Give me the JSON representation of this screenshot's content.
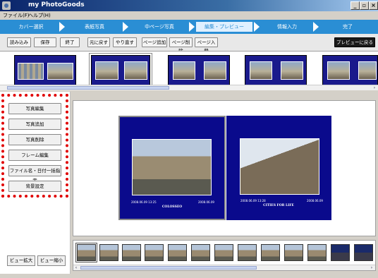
{
  "window": {
    "title": "my PhotoGoods",
    "minimize": "_",
    "maximize": "▫",
    "close": "×"
  },
  "menu": [
    "ファイル(F)",
    "ヘルプ(H)"
  ],
  "steps": [
    {
      "label": "カバー選択",
      "active": false
    },
    {
      "label": "表紙写真",
      "active": false
    },
    {
      "label": "中ページ写真",
      "active": false
    },
    {
      "label": "編集・プレビュー",
      "active": true
    },
    {
      "label": "情報入力",
      "active": false
    },
    {
      "label": "完了",
      "active": false
    }
  ],
  "toolbar": {
    "load": "読み込み",
    "save": "保存",
    "exit": "終了",
    "undo": "元に戻す",
    "redo": "やり直す",
    "add_page": "ページ追加",
    "delete_page": "ページ削除",
    "swap_page": "ページ入替",
    "back_to_preview": "プレビューに戻る"
  },
  "left_panel": {
    "buttons": [
      "写真編集",
      "写真追加",
      "写真削除",
      "フレーム編集",
      "ファイル名・日付一括指定",
      "背景設定"
    ],
    "zoom_in": "ビュー拡大",
    "zoom_out": "ビュー縮小"
  },
  "preview": {
    "left_page": {
      "caption_left": "2008.06.09  13:25",
      "caption_right": "2008.06.09",
      "title": "COLOSSEO"
    },
    "right_page": {
      "caption_left": "2008.06.09  13:28",
      "caption_right": "2008.06.09",
      "title": "CITIES FOR LIFE"
    }
  },
  "colors": {
    "accent": "#2a8ed4",
    "page_blue": "#0a0a8c",
    "highlight_red": "#e00000"
  }
}
